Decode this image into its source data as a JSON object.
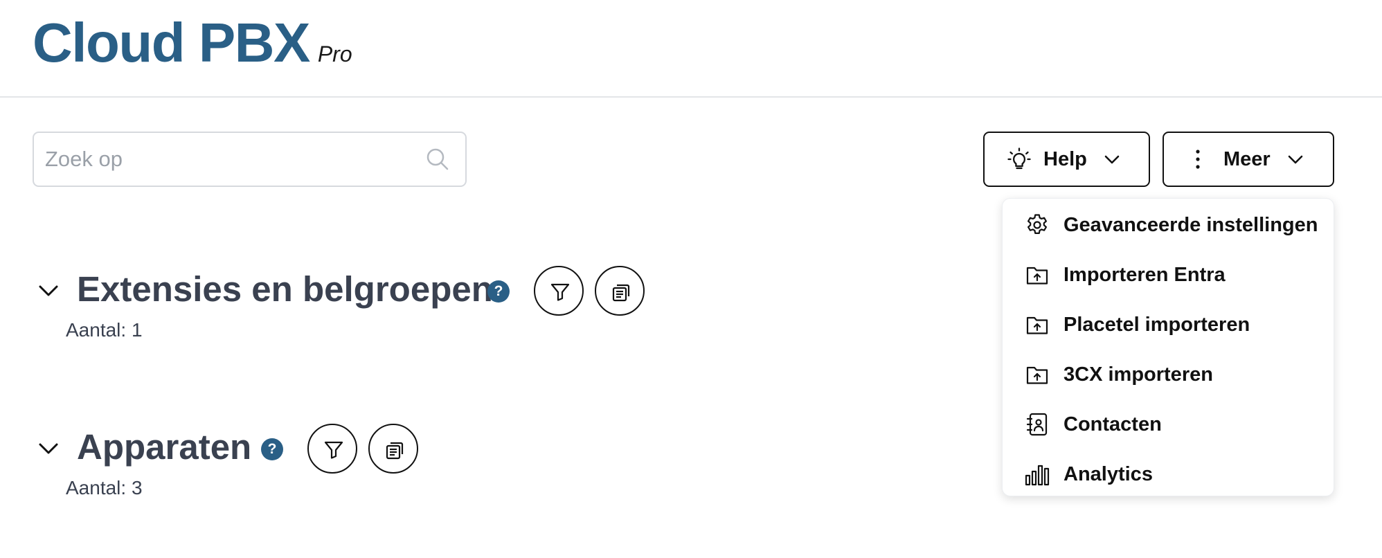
{
  "header": {
    "title": "Cloud PBX",
    "subtitle": "Pro"
  },
  "search": {
    "placeholder": "Zoek op",
    "value": ""
  },
  "toolbar": {
    "help_label": "Help",
    "more_label": "Meer"
  },
  "more_menu": {
    "items": [
      {
        "label": "Geavanceerde instellingen",
        "icon": "gear-icon"
      },
      {
        "label": "Importeren Entra",
        "icon": "folder-upload-icon"
      },
      {
        "label": "Placetel importeren",
        "icon": "folder-upload-icon"
      },
      {
        "label": "3CX importeren",
        "icon": "folder-upload-icon"
      },
      {
        "label": "Contacten",
        "icon": "contact-book-icon"
      },
      {
        "label": "Analytics",
        "icon": "bar-chart-icon"
      }
    ]
  },
  "sections": [
    {
      "title": "Extensies en belgroepen",
      "count_label": "Aantal: 1"
    },
    {
      "title": "Apparaten",
      "count_label": "Aantal: 3"
    }
  ],
  "colors": {
    "brand": "#2a5f86",
    "heading": "#3a4150",
    "border": "#111111"
  }
}
